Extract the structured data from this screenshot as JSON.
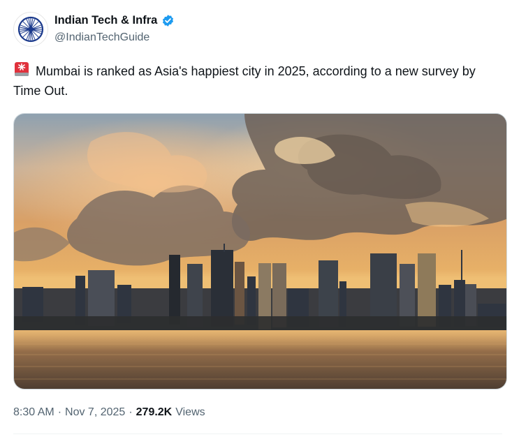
{
  "author": {
    "display_name": "Indian Tech & Infra",
    "handle": "@IndianTechGuide",
    "verified": true,
    "verified_color": "#1d9bf0",
    "avatar_icon": "ashoka-chakra-icon"
  },
  "tweet": {
    "emoji": "rotating-light-emoji",
    "text": "Mumbai is ranked as Asia's happiest city in 2025, according to a new survey by Time Out."
  },
  "media": {
    "type": "photo",
    "alt": "Mumbai skyline at sunset over the sea"
  },
  "meta": {
    "time": "8:30 AM",
    "separator": "·",
    "date": "Nov 7, 2025",
    "views_count": "279.2K",
    "views_label": "Views"
  },
  "colors": {
    "text_primary": "#0f1419",
    "text_secondary": "#536471",
    "chakra_blue": "#1b3a8c"
  }
}
